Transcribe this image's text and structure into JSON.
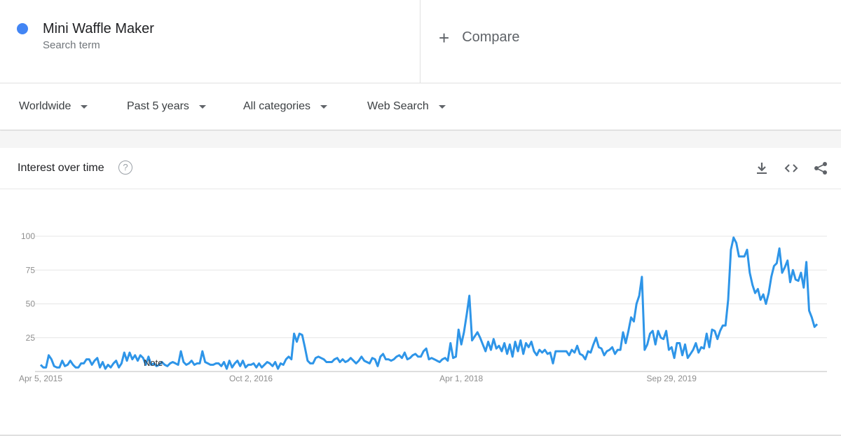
{
  "search_term": {
    "name": "Mini Waffle Maker",
    "subtitle": "Search term",
    "color": "#4285f4"
  },
  "compare": {
    "label": "Compare",
    "icon": "plus-icon"
  },
  "filters": [
    {
      "label": "Worldwide"
    },
    {
      "label": "Past 5 years"
    },
    {
      "label": "All categories"
    },
    {
      "label": "Web Search"
    }
  ],
  "card": {
    "title": "Interest over time",
    "help_icon": "?",
    "actions": [
      "download-icon",
      "embed-icon",
      "share-icon"
    ]
  },
  "chart_data": {
    "type": "line",
    "title": "Interest over time",
    "xlabel": "",
    "ylabel": "",
    "ylim": [
      0,
      100
    ],
    "y_ticks": [
      25,
      50,
      75,
      100
    ],
    "x_tick_labels": [
      "Apr 5, 2015",
      "Oct 2, 2016",
      "Apr 1, 2018",
      "Sep 29, 2019"
    ],
    "x_tick_indices": [
      0,
      78,
      156,
      234
    ],
    "grid": true,
    "annotation": "Note",
    "series": [
      {
        "name": "Mini Waffle Maker",
        "color": "#2e95e8",
        "values": [
          5,
          3,
          3,
          12,
          9,
          4,
          3,
          3,
          8,
          4,
          5,
          8,
          5,
          3,
          3,
          6,
          6,
          9,
          9,
          5,
          8,
          10,
          3,
          7,
          2,
          5,
          3,
          6,
          8,
          3,
          6,
          14,
          8,
          14,
          9,
          12,
          8,
          12,
          10,
          5,
          11,
          5,
          6,
          4,
          5,
          7,
          5,
          4,
          6,
          7,
          6,
          5,
          15,
          7,
          5,
          6,
          8,
          5,
          6,
          6,
          15,
          7,
          6,
          5,
          5,
          6,
          6,
          4,
          7,
          2,
          8,
          3,
          6,
          8,
          4,
          8,
          3,
          5,
          5,
          6,
          3,
          6,
          3,
          5,
          7,
          6,
          4,
          7,
          2,
          6,
          5,
          9,
          11,
          9,
          28,
          22,
          28,
          27,
          18,
          8,
          6,
          6,
          10,
          11,
          10,
          9,
          7,
          7,
          7,
          9,
          10,
          7,
          9,
          7,
          8,
          10,
          8,
          6,
          8,
          11,
          8,
          7,
          6,
          10,
          9,
          4,
          11,
          13,
          9,
          9,
          8,
          9,
          11,
          12,
          10,
          14,
          9,
          10,
          12,
          13,
          11,
          11,
          15,
          17,
          9,
          10,
          9,
          8,
          7,
          9,
          10,
          8,
          21,
          10,
          11,
          31,
          20,
          29,
          42,
          56,
          23,
          26,
          29,
          25,
          20,
          15,
          22,
          16,
          24,
          17,
          19,
          15,
          21,
          13,
          20,
          11,
          22,
          15,
          23,
          13,
          21,
          18,
          22,
          15,
          12,
          16,
          14,
          16,
          13,
          14,
          6,
          15,
          15,
          15,
          15,
          15,
          12,
          16,
          14,
          19,
          13,
          12,
          9,
          15,
          14,
          20,
          25,
          18,
          17,
          12,
          15,
          16,
          18,
          13,
          16,
          16,
          29,
          21,
          30,
          40,
          37,
          50,
          56,
          70,
          16,
          20,
          28,
          30,
          20,
          30,
          25,
          24,
          30,
          16,
          18,
          10,
          21,
          21,
          12,
          20,
          10,
          13,
          16,
          21,
          14,
          18,
          17,
          28,
          18,
          31,
          30,
          24,
          30,
          34,
          34,
          53,
          90,
          99,
          95,
          85,
          85,
          85,
          90,
          73,
          64,
          58,
          61,
          53,
          57,
          50,
          58,
          70,
          78,
          80,
          91,
          73,
          77,
          82,
          66,
          75,
          68,
          67,
          73,
          62,
          81,
          45,
          40,
          33,
          35
        ]
      }
    ]
  }
}
